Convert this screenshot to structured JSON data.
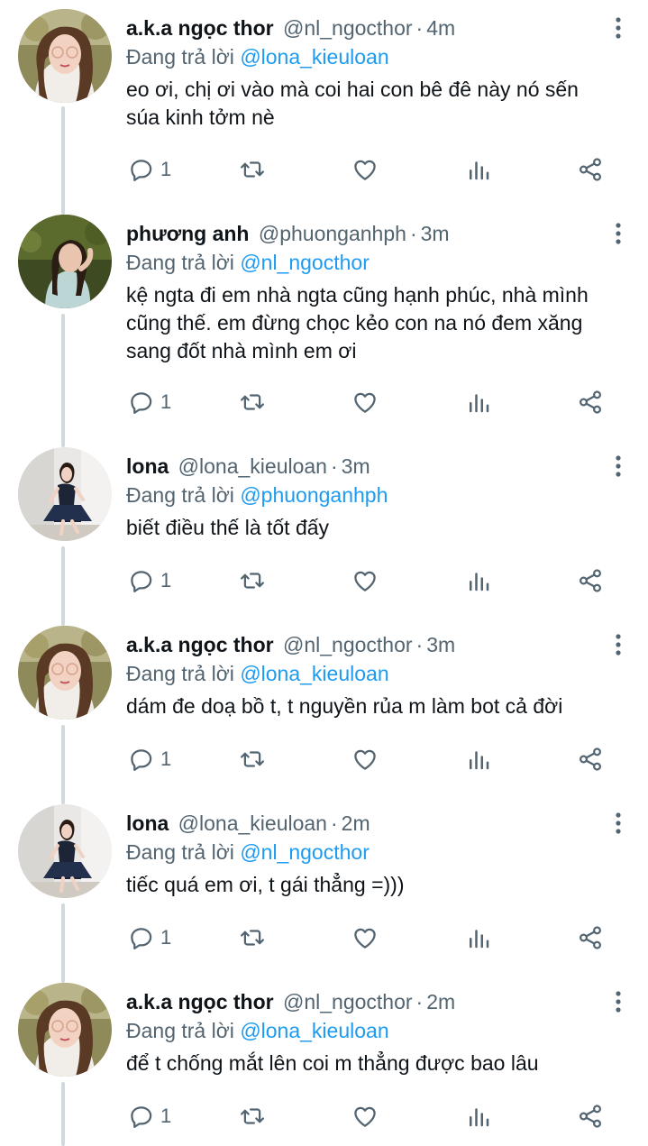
{
  "replying_label": "Đang trả lời",
  "colors": {
    "link": "#1d9bf0",
    "muted": "#536471",
    "text": "#0f1419",
    "thread_line": "#cfd9de"
  },
  "icons": {
    "reply": "reply-icon",
    "retweet": "retweet-icon",
    "like": "heart-icon",
    "views": "views-icon",
    "share": "share-icon",
    "more": "more-vertical-icon"
  },
  "tweets": [
    {
      "name": "a.k.a ngọc thor",
      "handle": "@nl_ngocthor",
      "sep": "·",
      "time": "4m",
      "reply_to": "@lona_kieuloan",
      "text": "eo ơi, chị ơi vào mà coi hai con bê đê này nó sến súa kinh tởm nè",
      "reply_count": "1",
      "avatar": "ngocthor"
    },
    {
      "name": "phương anh",
      "handle": "@phuonganhph",
      "sep": "·",
      "time": "3m",
      "reply_to": "@nl_ngocthor",
      "text": "kệ ngta đi em  nhà ngta cũng hạnh phúc, nhà mình cũng thế. em đừng chọc kẻo con na nó đem xăng sang đốt nhà mình em ơi",
      "reply_count": "1",
      "avatar": "phuonganh"
    },
    {
      "name": "lona",
      "handle": "@lona_kieuloan",
      "sep": "·",
      "time": "3m",
      "reply_to": "@phuonganhph",
      "text": "biết điều thế là tốt đấy",
      "reply_count": "1",
      "avatar": "lona"
    },
    {
      "name": "a.k.a ngọc thor",
      "handle": "@nl_ngocthor",
      "sep": "·",
      "time": "3m",
      "reply_to": "@lona_kieuloan",
      "text": "dám đe doạ bồ t, t nguyền rủa m làm bot cả đời",
      "reply_count": "1",
      "avatar": "ngocthor"
    },
    {
      "name": "lona",
      "handle": "@lona_kieuloan",
      "sep": "·",
      "time": "2m",
      "reply_to": "@nl_ngocthor",
      "text": "tiếc quá em ơi, t gái thẳng =)))",
      "reply_count": "1",
      "avatar": "lona"
    },
    {
      "name": "a.k.a ngọc thor",
      "handle": "@nl_ngocthor",
      "sep": "·",
      "time": "2m",
      "reply_to": "@lona_kieuloan",
      "text": "để t chống mắt lên coi m thẳng được bao lâu",
      "reply_count": "1",
      "avatar": "ngocthor"
    }
  ]
}
